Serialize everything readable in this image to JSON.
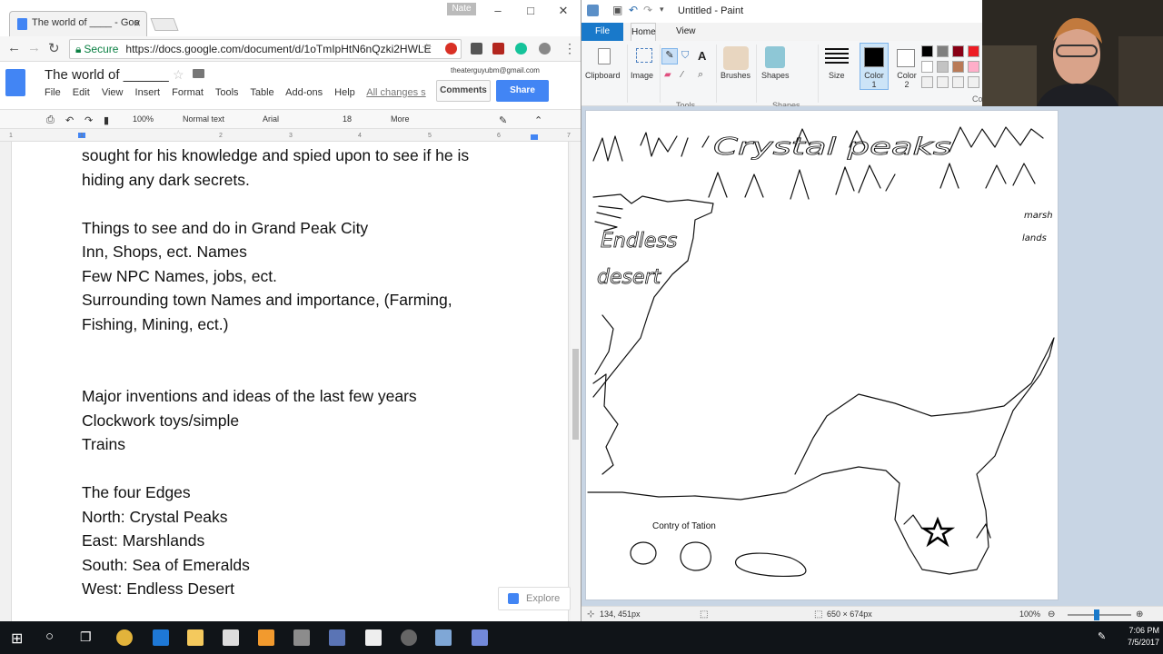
{
  "chrome": {
    "tab_title": "The world of ____ - Goo",
    "profile_name": "Nate",
    "url_secure": "Secure",
    "url": "https://docs.google.com/document/d/1oTmIpHtN6nQzki2HWLE",
    "doc_title": "The world of ______",
    "account_email": "theaterguyubm@gmail.com",
    "menu": [
      "File",
      "Edit",
      "View",
      "Insert",
      "Format",
      "Tools",
      "Table",
      "Add-ons",
      "Help"
    ],
    "all_changes": "All changes s",
    "comments_label": "Comments",
    "share_label": "Share",
    "toolbar": {
      "zoom": "100%",
      "style": "Normal text",
      "font": "Arial",
      "size": "18",
      "more": "More"
    },
    "ruler_numbers": [
      "1",
      "1",
      "2",
      "3",
      "4",
      "5",
      "6",
      "7"
    ],
    "explore_label": "Explore"
  },
  "document": {
    "lines": [
      "sought for his knowledge and spied upon to see if he is",
      "hiding any dark secrets.",
      "",
      "Things to see and do in Grand Peak City",
      "Inn, Shops, ect. Names",
      "Few NPC Names, jobs, ect.",
      "Surrounding town Names and importance, (Farming,",
      "Fishing, Mining, ect.)",
      "",
      "",
      "Major inventions and ideas of the last few years",
      "Clockwork toys/simple",
      "Trains",
      "",
      "The four Edges",
      "North: Crystal Peaks",
      "East: Marshlands",
      "South: Sea of Emeralds",
      "West: Endless Desert"
    ]
  },
  "paint": {
    "window_title": "Untitled - Paint",
    "tabs": {
      "file": "File",
      "home": "Home",
      "view": "View"
    },
    "tools": {
      "clipboard": "Clipboard",
      "image": "Image",
      "brushes": "Brushes",
      "shapes": "Shapes",
      "size": "Size",
      "color1": "Color 1",
      "color2": "Color 2",
      "colors": "Colors"
    },
    "groups": {
      "tools": "Tools",
      "shapes": "Shapes"
    },
    "canvas_text": "Contry of Tation",
    "sketch_text": {
      "peaks": "Crystal peaks",
      "desert1": "Endless",
      "desert2": "desert",
      "marsh1": "marsh",
      "marsh2": "lands"
    },
    "status": {
      "cursor": "134, 451px",
      "size": "650 × 674px",
      "zoom": "100%"
    },
    "palette": [
      "#000000",
      "#7f7f7f",
      "#880015",
      "#ed1c24",
      "#ffffff",
      "#c3c3c3",
      "#b97a57",
      "#ffaec9",
      "#f0f0f0",
      "#f0f0f0",
      "#f0f0f0",
      "#f0f0f0"
    ]
  },
  "taskbar": {
    "time": "7:06 PM",
    "date": "7/5/2017"
  }
}
